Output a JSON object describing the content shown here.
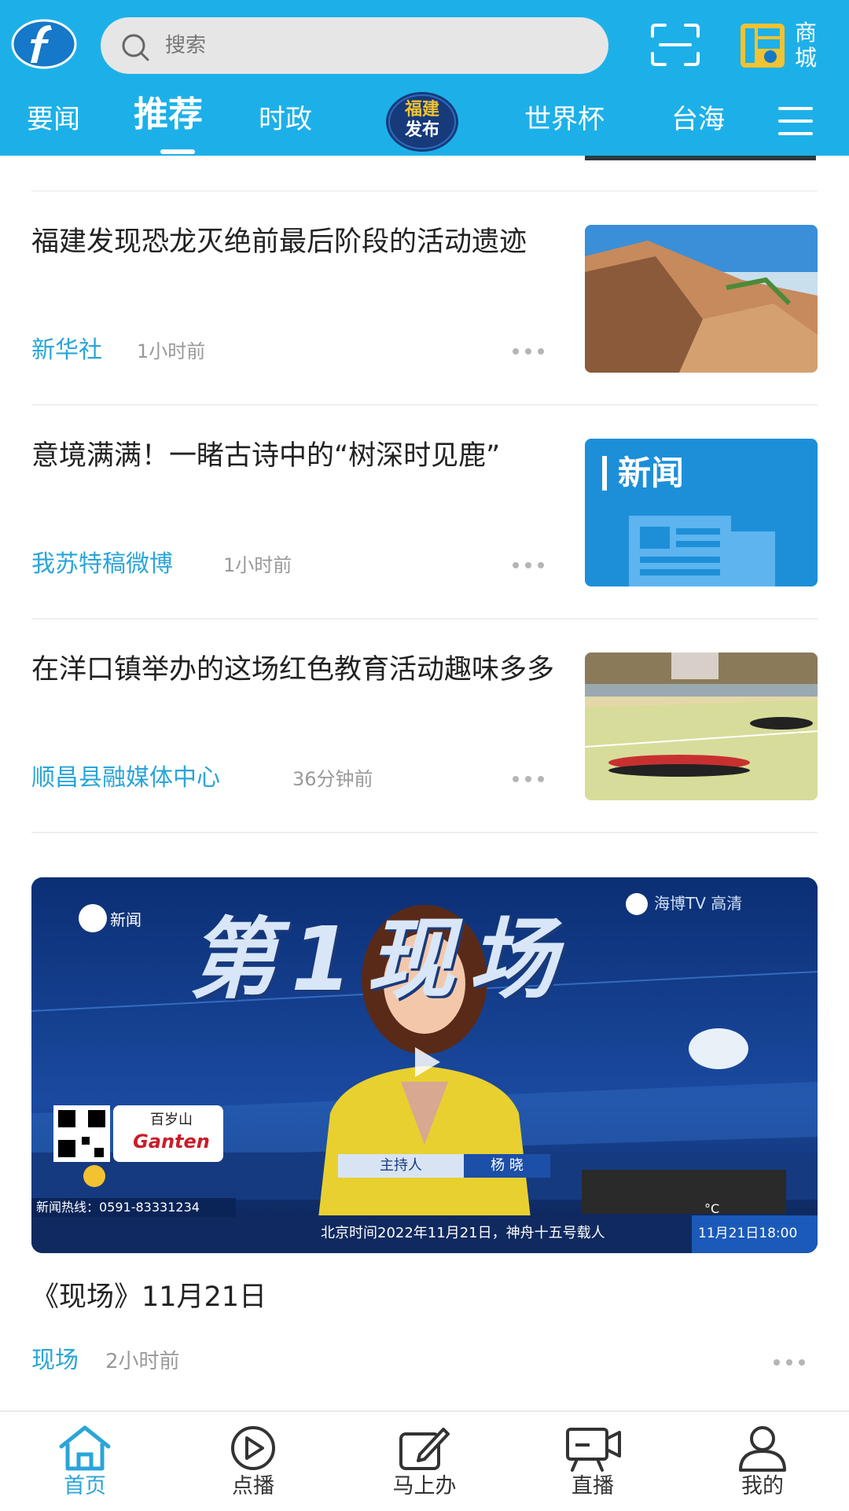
{
  "header": {
    "search_placeholder": "搜索",
    "mall_label": "商城",
    "fj_badge_line1": "福建",
    "fj_badge_line2": "发布",
    "tabs": [
      {
        "label": "要闻"
      },
      {
        "label": "推荐",
        "active": true
      },
      {
        "label": "时政"
      },
      {
        "label": "世界杯"
      },
      {
        "label": "台海"
      }
    ],
    "brand_color": "#1db0e8"
  },
  "articles": [
    {
      "title": "福建发现恐龙灭绝前最后阶段的活动遗迹",
      "source": "新华社",
      "time": "1小时前"
    },
    {
      "title": "意境满满！一睹古诗中的“树深时见鹿”",
      "source": "我苏特稿微博",
      "time": "1小时前",
      "thumb_text": "新闻"
    },
    {
      "title": "在洋口镇举办的这场红色教育活动趣味多多",
      "source": "顺昌县融媒体中心",
      "time": "36分钟前"
    }
  ],
  "video": {
    "title": "《现场》11月21日",
    "source": "现场",
    "time": "2小时前",
    "overlay": {
      "show_name": "第1现场",
      "news_tag": "新闻",
      "channel": "海博TV 高清",
      "host_label": "主持人",
      "host_name": "杨 晓",
      "hotline": "新闻热线：0591-83331234",
      "ticker": "北京时间2022年11月21日，神舟十五号载人",
      "datetime": "11月21日18:00",
      "ad_line1": "百岁山",
      "ad_line2": "Ganten",
      "temp_unit": "°C"
    }
  },
  "bottom_nav": [
    {
      "label": "首页",
      "active": true
    },
    {
      "label": "点播"
    },
    {
      "label": "马上办"
    },
    {
      "label": "直播"
    },
    {
      "label": "我的"
    }
  ],
  "accent_color": "#2aa5d8"
}
